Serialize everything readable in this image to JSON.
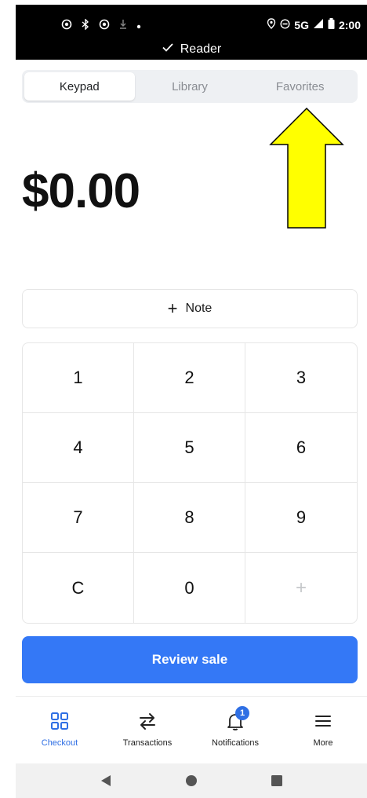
{
  "status_bar": {
    "time": "2:00",
    "network": "5G",
    "reader_label": "Reader"
  },
  "tabs": [
    {
      "label": "Keypad",
      "active": true
    },
    {
      "label": "Library",
      "active": false
    },
    {
      "label": "Favorites",
      "active": false
    }
  ],
  "amount": "$0.00",
  "note_label": "Note",
  "keypad": [
    "1",
    "2",
    "3",
    "4",
    "5",
    "6",
    "7",
    "8",
    "9",
    "C",
    "0",
    "+"
  ],
  "review_label": "Review sale",
  "bottom_nav": {
    "checkout": "Checkout",
    "transactions": "Transactions",
    "notifications": "Notifications",
    "notifications_badge": "1",
    "more": "More"
  },
  "colors": {
    "accent": "#3478f6",
    "annotation_arrow": "#ffff00"
  }
}
